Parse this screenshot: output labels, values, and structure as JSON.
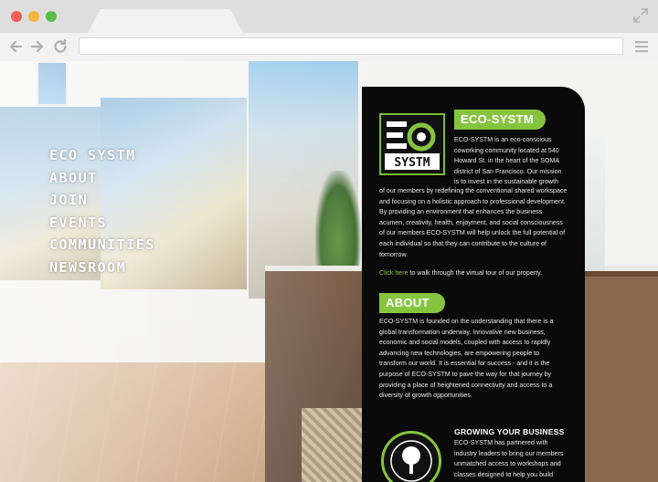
{
  "browser": {
    "url": "",
    "icons": {
      "close": "red-dot",
      "minimize": "yellow-dot",
      "maximize": "green-dot",
      "back": "arrow-left-icon",
      "forward": "arrow-right-icon",
      "reload": "reload-icon",
      "expand": "expand-icon",
      "menu": "hamburger-menu-icon"
    },
    "colors": {
      "chrome": "#e6e6e6",
      "close": "#ed5f57",
      "minimize": "#f2b63f",
      "maximize": "#5dbd4a"
    }
  },
  "site": {
    "accent": "#86c440",
    "nav": [
      "ECO SYSTM",
      "ABOUT",
      "JOIN",
      "EVENTS",
      "COMMUNITIES",
      "NEWSROOM"
    ],
    "logo_text": "SYSTM",
    "section1": {
      "title": "ECO-SYSTM",
      "intro": "ECO-SYSTM is an eco-conscious coworking community located at 540 Howard St. in the heart of the SOMA district of San Francisco. Our mission is to invest in the sustainable growth",
      "intro_cont": "of our members by redefining the conventional shared workspace and focusing on a holistic approach to professional development.  By providing an environment that enhances the business acumen, creativity, health, enjoyment, and social consciousness of our members ECO-SYSTM will help unlock the full potential of each individual so that they can contribute to the culture of tomorrow.",
      "tour_link": "Click here",
      "tour_rest": " to walk through the virtual tour of our property."
    },
    "section2": {
      "title": "ABOUT",
      "body": "ECO-SYSTM is founded on the understanding that there is a global transformation underway. Innovative new business, economic and social models, coupled with access to rapidly advancing new technologies, are empowering people to transform our world. It is essential for success - and it is the purpose of ECO-SYSTM to pave the way for that journey by providing a place of heightened connectivity and access to a diversity of growth opportunities."
    },
    "section3": {
      "title": "GROWING YOUR BUSINESS",
      "body": "ECO-SYSTM has partnered with industry leaders to bring our members unmatched access to workshops and classes designed to help you build",
      "badge_icon": "tree-icon"
    }
  }
}
